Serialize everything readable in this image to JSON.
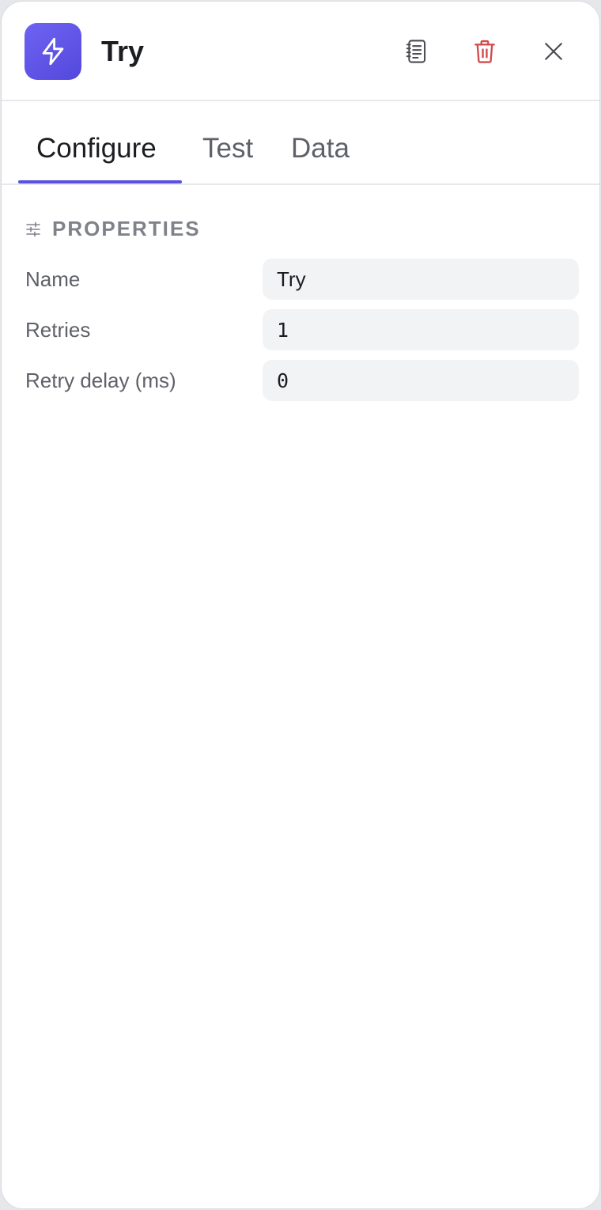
{
  "node": {
    "title": "Try",
    "icon": "lightning-bolt-icon",
    "accent": "#5b50e0"
  },
  "header": {
    "actions": [
      {
        "name": "notes-icon"
      },
      {
        "name": "trash-icon",
        "color": "#d24a4a"
      },
      {
        "name": "close-icon"
      }
    ]
  },
  "tabs": [
    {
      "label": "Configure",
      "active": true
    },
    {
      "label": "Test",
      "active": false
    },
    {
      "label": "Data",
      "active": false
    }
  ],
  "properties": {
    "section_title": "PROPERTIES",
    "section_icon": "sliders-icon",
    "fields": [
      {
        "label": "Name",
        "value": "Try"
      },
      {
        "label": "Retries",
        "value": "1"
      },
      {
        "label": "Retry delay (ms)",
        "value": "0"
      }
    ]
  }
}
